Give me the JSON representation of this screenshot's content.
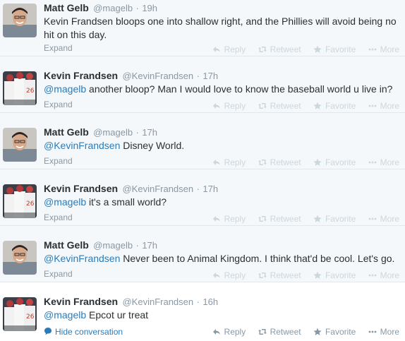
{
  "tweets": [
    {
      "fullname": "Matt Gelb",
      "screenname": "@magelb",
      "time": "19h",
      "mention": "",
      "text": "Kevin Frandsen bloops one into shallow right, and the Phillies will avoid being no hit on this day.",
      "footer_link": "Expand",
      "avatar": "matt"
    },
    {
      "fullname": "Kevin Frandsen",
      "screenname": "@KevinFrandsen",
      "time": "17h",
      "mention": "@magelb",
      "text": " another bloop? Man I would love to know the baseball world u live in?",
      "footer_link": "Expand",
      "avatar": "kevin"
    },
    {
      "fullname": "Matt Gelb",
      "screenname": "@magelb",
      "time": "17h",
      "mention": "@KevinFrandsen",
      "text": " Disney World.",
      "footer_link": "Expand",
      "avatar": "matt"
    },
    {
      "fullname": "Kevin Frandsen",
      "screenname": "@KevinFrandsen",
      "time": "17h",
      "mention": "@magelb",
      "text": " it's a small world?",
      "footer_link": "Expand",
      "avatar": "kevin"
    },
    {
      "fullname": "Matt Gelb",
      "screenname": "@magelb",
      "time": "17h",
      "mention": "@KevinFrandsen",
      "text": " Never been to Animal Kingdom. I think that'd be cool. Let's go.",
      "footer_link": "Expand",
      "avatar": "matt"
    },
    {
      "fullname": "Kevin Frandsen",
      "screenname": "@KevinFrandsen",
      "time": "16h",
      "mention": "@magelb",
      "text": " Epcot ur treat",
      "footer_link": "Hide conversation",
      "avatar": "kevin"
    }
  ],
  "actions": {
    "reply": "Reply",
    "retweet": "Retweet",
    "favorite": "Favorite",
    "more": "More"
  },
  "separator": "·",
  "icons": {
    "reply": "reply-arrow-icon",
    "retweet": "retweet-icon",
    "favorite": "star-icon",
    "more": "more-dots-icon",
    "hide": "speech-bubble-icon"
  },
  "colors": {
    "text": "#292f33",
    "muted": "#8899a6",
    "link": "#2b7bb9",
    "faded": "#ccd6dd"
  }
}
